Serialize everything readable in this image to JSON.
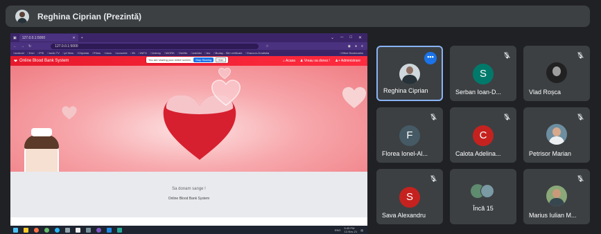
{
  "presenter": {
    "name": "Reghina Ciprian (Prezintă)"
  },
  "browser": {
    "tab_title": "127.0.0.1:5000",
    "new_tab": "+",
    "url": "127.0.0.1:5000",
    "bookmarks": [
      "android",
      "Hori",
      "PSI",
      "radio TV",
      "pf films",
      "Clipdata",
      "Films",
      "docs",
      "concerte",
      "BI",
      "INFO",
      "Udemy",
      "WORK",
      "Netflix",
      "wishlist",
      "dw",
      "Buday - Stiri verificate",
      "Dacoon-Gradistia"
    ],
    "other_bookmarks": "Other Bookmarks"
  },
  "share_banner": {
    "text": "You are sharing your entire screen.",
    "stop": "Stop Sharing",
    "hide": "Hide"
  },
  "site": {
    "brand": "Online Blood Bank System",
    "nav": [
      "Acasa",
      "Vreau sa donez !",
      "Administrare"
    ],
    "slogan": "Sa donam sange !",
    "system": "Online Blood Bank System"
  },
  "taskbar": {
    "lang": "ENG",
    "time": "5:45 PM",
    "date": "12-Nov-21"
  },
  "participants": [
    {
      "name": "Reghina Ciprian",
      "type": "photo",
      "active": true,
      "more": "•••"
    },
    {
      "name": "Serban Ioan-D...",
      "type": "letter",
      "letter": "S",
      "color": "#00796b",
      "muted": true
    },
    {
      "name": "Vlad Roșca",
      "type": "photo",
      "muted": true
    },
    {
      "name": "Florea Ionel-Al...",
      "type": "letter",
      "letter": "F",
      "color": "#455a64",
      "muted": true
    },
    {
      "name": "Calota Adelina...",
      "type": "letter",
      "letter": "C",
      "color": "#c5221f",
      "muted": true
    },
    {
      "name": "Petrisor Marian",
      "type": "photo",
      "muted": true
    },
    {
      "name": "Sava Alexandru",
      "type": "letter",
      "letter": "S",
      "color": "#c5221f",
      "muted": true
    },
    {
      "name": "Încă 15",
      "type": "more"
    },
    {
      "name": "Marius Iulian M...",
      "type": "photo",
      "muted": true
    }
  ]
}
